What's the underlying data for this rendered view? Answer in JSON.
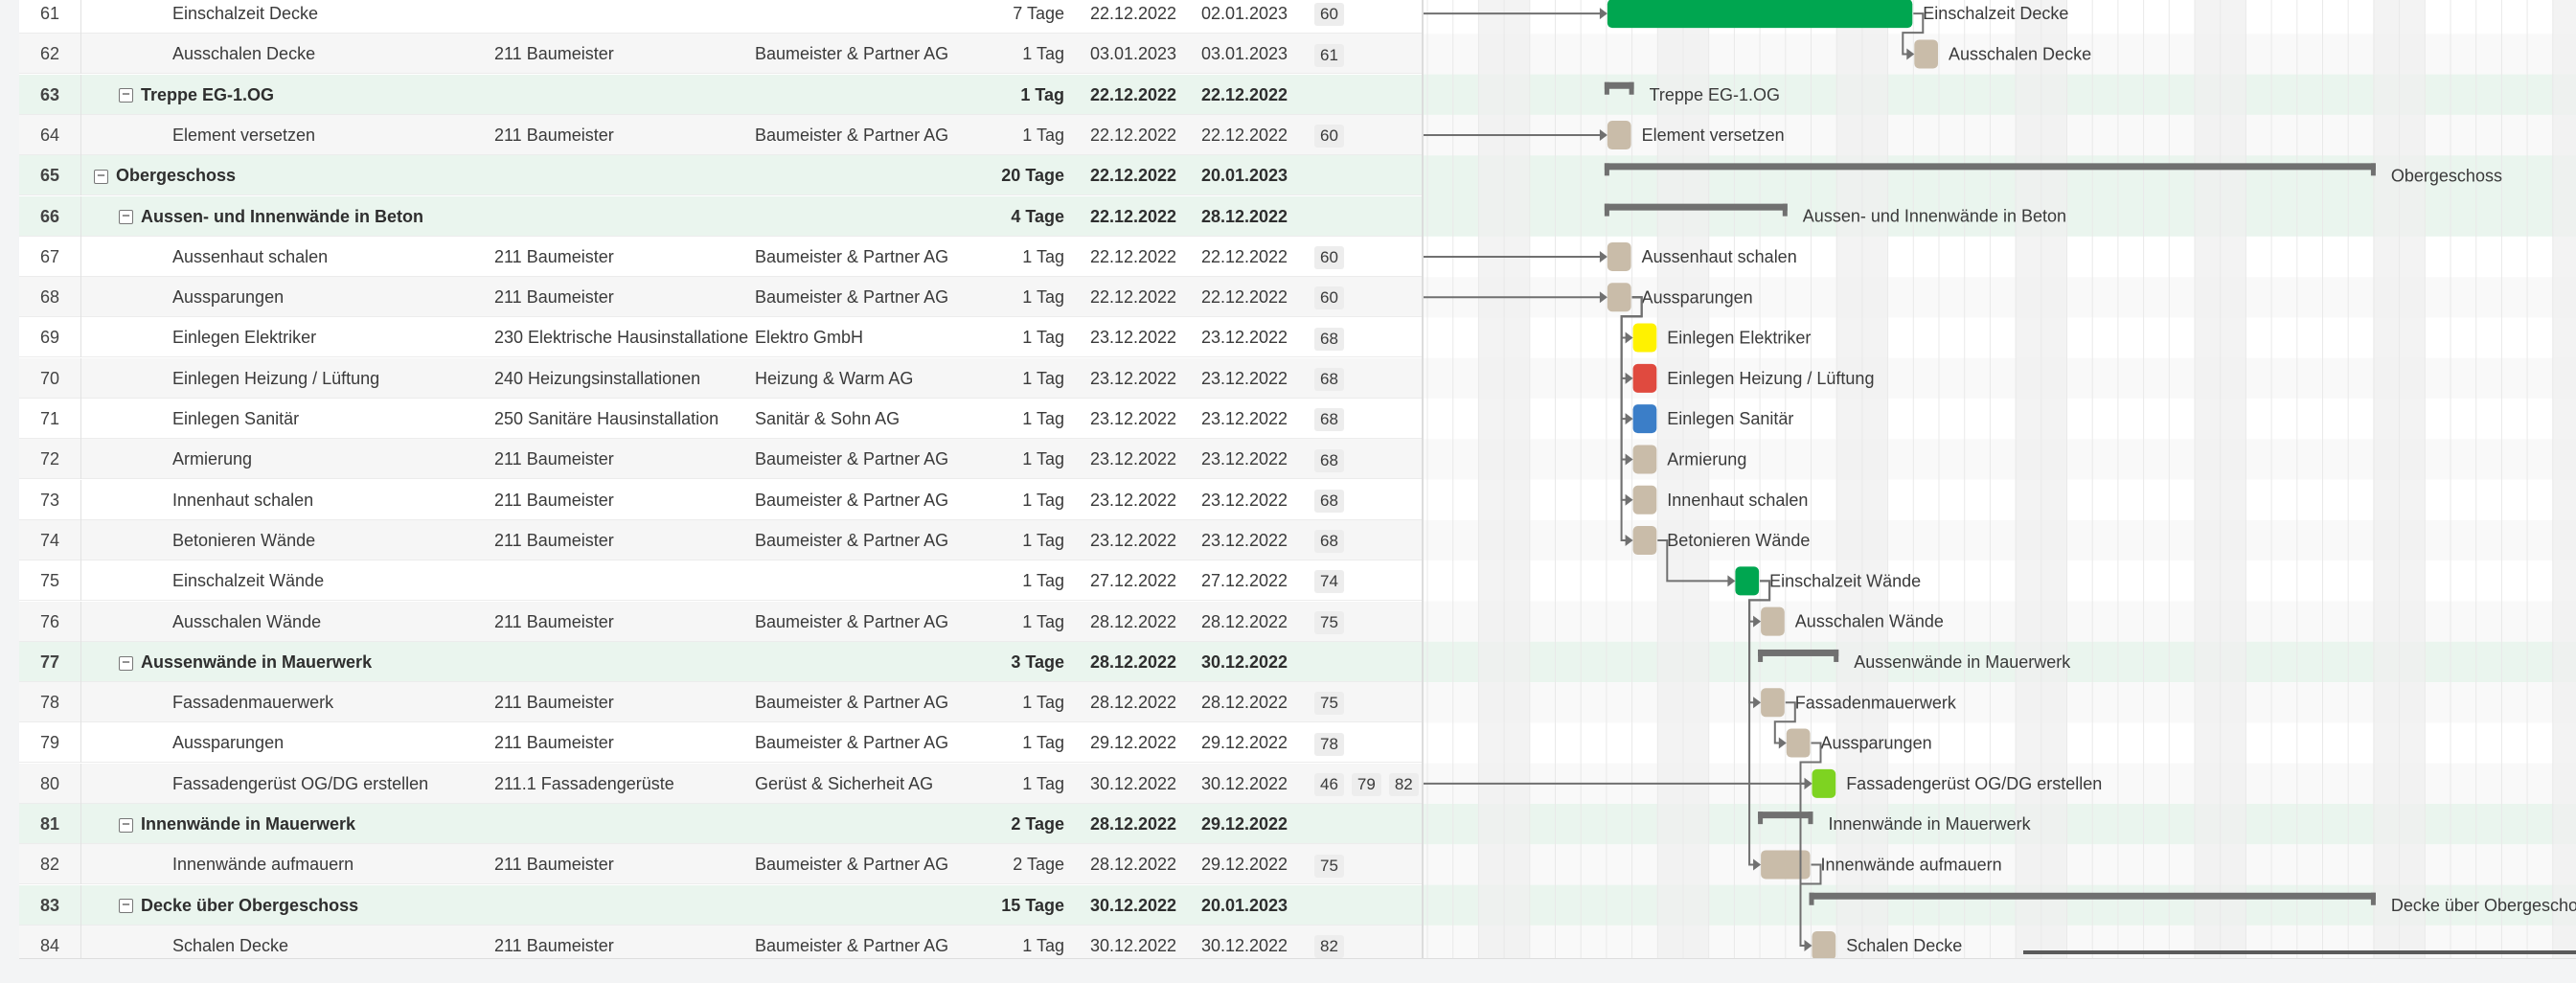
{
  "colors": {
    "group_row_bg": "#eaf5ee",
    "alt_row_bg": "#f6f6f6",
    "summary_bar": "#707070",
    "task_default": "#c9bca9",
    "milestone_green": "#00a650",
    "electrical_yellow": "#fff200",
    "hvac_red": "#e04a3f",
    "sanitary_blue": "#3b7ec8",
    "scaffold_lime": "#7ed321",
    "weekend_shade": "#efefef"
  },
  "rows": [
    {
      "id": "61",
      "task": "Einschalzeit Decke",
      "trade": "",
      "firm": "",
      "duration": "7 Tage",
      "start": "22.12.2022",
      "end": "02.01.2023",
      "preds": [
        "60"
      ],
      "level": 2,
      "group": false,
      "color": "milestone_green"
    },
    {
      "id": "62",
      "task": "Ausschalen Decke",
      "trade": "211 Baumeister",
      "firm": "Baumeister & Partner AG",
      "duration": "1 Tag",
      "start": "03.01.2023",
      "end": "03.01.2023",
      "preds": [
        "61"
      ],
      "level": 2,
      "group": false,
      "color": "task_default"
    },
    {
      "id": "63",
      "task": "Treppe EG-1.OG",
      "trade": "",
      "firm": "",
      "duration": "1 Tag",
      "start": "22.12.2022",
      "end": "22.12.2022",
      "preds": [],
      "level": 1,
      "group": true
    },
    {
      "id": "64",
      "task": "Element versetzen",
      "trade": "211 Baumeister",
      "firm": "Baumeister & Partner AG",
      "duration": "1 Tag",
      "start": "22.12.2022",
      "end": "22.12.2022",
      "preds": [
        "60"
      ],
      "level": 2,
      "group": false,
      "color": "task_default"
    },
    {
      "id": "65",
      "task": "Obergeschoss",
      "trade": "",
      "firm": "",
      "duration": "20 Tage",
      "start": "22.12.2022",
      "end": "20.01.2023",
      "preds": [],
      "level": 0,
      "group": true
    },
    {
      "id": "66",
      "task": "Aussen- und Innenwände in Beton",
      "trade": "",
      "firm": "",
      "duration": "4 Tage",
      "start": "22.12.2022",
      "end": "28.12.2022",
      "preds": [],
      "level": 1,
      "group": true
    },
    {
      "id": "67",
      "task": "Aussenhaut schalen",
      "trade": "211 Baumeister",
      "firm": "Baumeister & Partner AG",
      "duration": "1 Tag",
      "start": "22.12.2022",
      "end": "22.12.2022",
      "preds": [
        "60"
      ],
      "level": 2,
      "group": false,
      "color": "task_default"
    },
    {
      "id": "68",
      "task": "Aussparungen",
      "trade": "211 Baumeister",
      "firm": "Baumeister & Partner AG",
      "duration": "1 Tag",
      "start": "22.12.2022",
      "end": "22.12.2022",
      "preds": [
        "60"
      ],
      "level": 2,
      "group": false,
      "color": "task_default"
    },
    {
      "id": "69",
      "task": "Einlegen Elektriker",
      "trade": "230 Elektrische Hausinstallatione",
      "firm": "Elektro GmbH",
      "duration": "1 Tag",
      "start": "23.12.2022",
      "end": "23.12.2022",
      "preds": [
        "68"
      ],
      "level": 2,
      "group": false,
      "color": "electrical_yellow"
    },
    {
      "id": "70",
      "task": "Einlegen Heizung / Lüftung",
      "trade": "240 Heizungsinstallationen",
      "firm": "Heizung & Warm AG",
      "duration": "1 Tag",
      "start": "23.12.2022",
      "end": "23.12.2022",
      "preds": [
        "68"
      ],
      "level": 2,
      "group": false,
      "color": "hvac_red"
    },
    {
      "id": "71",
      "task": "Einlegen Sanitär",
      "trade": "250 Sanitäre Hausinstallation",
      "firm": "Sanitär & Sohn AG",
      "duration": "1 Tag",
      "start": "23.12.2022",
      "end": "23.12.2022",
      "preds": [
        "68"
      ],
      "level": 2,
      "group": false,
      "color": "sanitary_blue"
    },
    {
      "id": "72",
      "task": "Armierung",
      "trade": "211 Baumeister",
      "firm": "Baumeister & Partner AG",
      "duration": "1 Tag",
      "start": "23.12.2022",
      "end": "23.12.2022",
      "preds": [
        "68"
      ],
      "level": 2,
      "group": false,
      "color": "task_default"
    },
    {
      "id": "73",
      "task": "Innenhaut schalen",
      "trade": "211 Baumeister",
      "firm": "Baumeister & Partner AG",
      "duration": "1 Tag",
      "start": "23.12.2022",
      "end": "23.12.2022",
      "preds": [
        "68"
      ],
      "level": 2,
      "group": false,
      "color": "task_default"
    },
    {
      "id": "74",
      "task": "Betonieren Wände",
      "trade": "211 Baumeister",
      "firm": "Baumeister & Partner AG",
      "duration": "1 Tag",
      "start": "23.12.2022",
      "end": "23.12.2022",
      "preds": [
        "68"
      ],
      "level": 2,
      "group": false,
      "color": "task_default"
    },
    {
      "id": "75",
      "task": "Einschalzeit Wände",
      "trade": "",
      "firm": "",
      "duration": "1 Tag",
      "start": "27.12.2022",
      "end": "27.12.2022",
      "preds": [
        "74"
      ],
      "level": 2,
      "group": false,
      "color": "milestone_green"
    },
    {
      "id": "76",
      "task": "Ausschalen Wände",
      "trade": "211 Baumeister",
      "firm": "Baumeister & Partner AG",
      "duration": "1 Tag",
      "start": "28.12.2022",
      "end": "28.12.2022",
      "preds": [
        "75"
      ],
      "level": 2,
      "group": false,
      "color": "task_default"
    },
    {
      "id": "77",
      "task": "Aussenwände in Mauerwerk",
      "trade": "",
      "firm": "",
      "duration": "3 Tage",
      "start": "28.12.2022",
      "end": "30.12.2022",
      "preds": [],
      "level": 1,
      "group": true
    },
    {
      "id": "78",
      "task": "Fassadenmauerwerk",
      "trade": "211 Baumeister",
      "firm": "Baumeister & Partner AG",
      "duration": "1 Tag",
      "start": "28.12.2022",
      "end": "28.12.2022",
      "preds": [
        "75"
      ],
      "level": 2,
      "group": false,
      "color": "task_default"
    },
    {
      "id": "79",
      "task": "Aussparungen",
      "trade": "211 Baumeister",
      "firm": "Baumeister & Partner AG",
      "duration": "1 Tag",
      "start": "29.12.2022",
      "end": "29.12.2022",
      "preds": [
        "78"
      ],
      "level": 2,
      "group": false,
      "color": "task_default"
    },
    {
      "id": "80",
      "task": "Fassadengerüst OG/DG erstellen",
      "trade": "211.1 Fassadengerüste",
      "firm": "Gerüst & Sicherheit AG",
      "duration": "1 Tag",
      "start": "30.12.2022",
      "end": "30.12.2022",
      "preds": [
        "46",
        "79",
        "82"
      ],
      "level": 2,
      "group": false,
      "color": "scaffold_lime"
    },
    {
      "id": "81",
      "task": "Innenwände in Mauerwerk",
      "trade": "",
      "firm": "",
      "duration": "2 Tage",
      "start": "28.12.2022",
      "end": "29.12.2022",
      "preds": [],
      "level": 1,
      "group": true
    },
    {
      "id": "82",
      "task": "Innenwände aufmauern",
      "trade": "211 Baumeister",
      "firm": "Baumeister & Partner AG",
      "duration": "2 Tage",
      "start": "28.12.2022",
      "end": "29.12.2022",
      "preds": [
        "75"
      ],
      "level": 2,
      "group": false,
      "color": "task_default"
    },
    {
      "id": "83",
      "task": "Decke über Obergeschoss",
      "trade": "",
      "firm": "",
      "duration": "15 Tage",
      "start": "30.12.2022",
      "end": "20.01.2023",
      "preds": [],
      "level": 1,
      "group": true
    },
    {
      "id": "84",
      "task": "Schalen Decke",
      "trade": "211 Baumeister",
      "firm": "Baumeister & Partner AG",
      "duration": "1 Tag",
      "start": "30.12.2022",
      "end": "30.12.2022",
      "preds": [
        "82"
      ],
      "level": 2,
      "group": false,
      "color": "task_default"
    }
  ]
}
